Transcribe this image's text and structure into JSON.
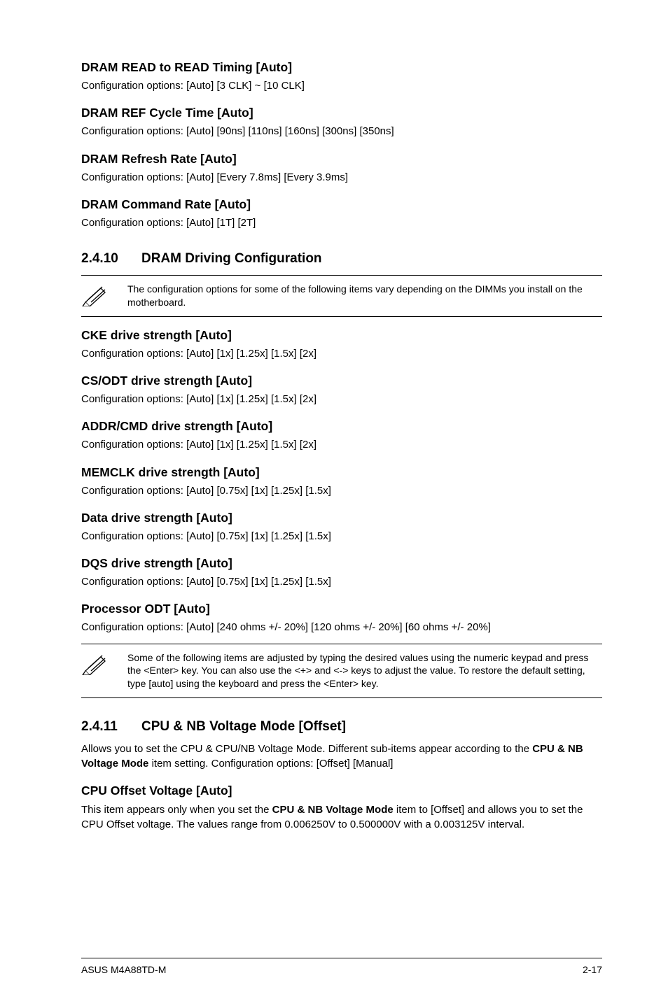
{
  "sections_a": [
    {
      "title": "DRAM READ to READ Timing [Auto]",
      "body": "Configuration options: [Auto] [3 CLK] ~ [10 CLK]"
    },
    {
      "title": "DRAM REF Cycle Time [Auto]",
      "body": "Configuration options: [Auto] [90ns] [110ns] [160ns] [300ns] [350ns]"
    },
    {
      "title": "DRAM Refresh Rate [Auto]",
      "body": "Configuration options: [Auto] [Every 7.8ms] [Every 3.9ms]"
    },
    {
      "title": "DRAM Command Rate [Auto]",
      "body": "Configuration options: [Auto] [1T] [2T]"
    }
  ],
  "sec2410": {
    "num": "2.4.10",
    "title": "DRAM Driving Configuration"
  },
  "note1": "The configuration options for some of the following items vary depending on the DIMMs you install on the motherboard.",
  "sections_b": [
    {
      "title": "CKE drive strength [Auto]",
      "body": "Configuration options: [Auto] [1x] [1.25x] [1.5x] [2x]"
    },
    {
      "title": "CS/ODT drive strength [Auto]",
      "body": "Configuration options: [Auto] [1x] [1.25x] [1.5x] [2x]"
    },
    {
      "title": "ADDR/CMD drive strength [Auto]",
      "body": "Configuration options: [Auto] [1x] [1.25x] [1.5x] [2x]"
    },
    {
      "title": "MEMCLK drive strength [Auto]",
      "body": "Configuration options: [Auto] [0.75x] [1x] [1.25x] [1.5x]"
    },
    {
      "title": "Data drive strength [Auto]",
      "body": "Configuration options: [Auto] [0.75x] [1x] [1.25x] [1.5x]"
    },
    {
      "title": "DQS drive strength [Auto]",
      "body": "Configuration options: [Auto] [0.75x] [1x] [1.25x] [1.5x]"
    },
    {
      "title": "Processor ODT [Auto]",
      "body": "Configuration options: [Auto] [240 ohms +/- 20%] [120 ohms +/- 20%] [60 ohms +/- 20%]"
    }
  ],
  "note2": "Some of the following items are adjusted by typing the desired values using the numeric keypad and press the <Enter> key. You can also use the <+> and <-> keys to adjust the value. To restore the default setting, type [auto] using the keyboard and press the <Enter> key.",
  "sec2411": {
    "num": "2.4.11",
    "title": "CPU & NB Voltage Mode [Offset]"
  },
  "para2411_pre": "Allows you to set the CPU & CPU/NB Voltage Mode. Different sub-items appear according to the ",
  "para2411_bold": "CPU & NB Voltage Mode",
  "para2411_post": " item setting. Configuration options: [Offset] [Manual]",
  "sub2411": {
    "title": "CPU Offset Voltage [Auto]"
  },
  "sub2411_para_pre": "This item appears only when you set the ",
  "sub2411_para_bold": "CPU & NB Voltage Mode",
  "sub2411_para_post": " item to [Offset] and allows you to set the CPU Offset voltage. The values range from 0.006250V to 0.500000V with a 0.003125V interval.",
  "footer": {
    "left": "ASUS M4A88TD-M",
    "right": "2-17"
  }
}
